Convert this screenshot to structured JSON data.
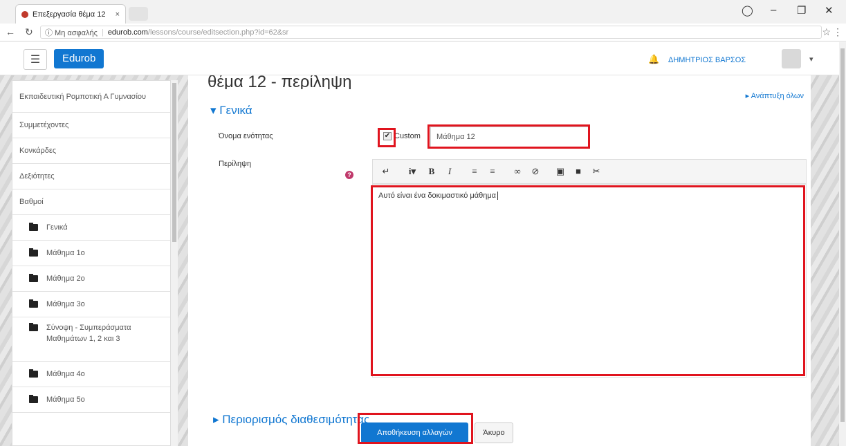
{
  "browser": {
    "tab_title": "Επεξεργασία θέμα 12",
    "tab_close": "×",
    "security_label": "ⓘ Μη ασφαλής",
    "url_domain": "edurob.com",
    "url_path": "/lessons/course/editsection.php?id=62&sr"
  },
  "navbar": {
    "brand": "Edurob",
    "username": "ΔΗΜΗΤΡΙΟΣ ΒΑΡΣΟΣ"
  },
  "sidebar": {
    "items": [
      {
        "label": "Εκπαιδευτική Ρομποτική Α Γυμνασίου",
        "folder": false
      },
      {
        "label": "Συμμετέχοντες",
        "folder": false
      },
      {
        "label": "Κονκάρδες",
        "folder": false
      },
      {
        "label": "Δεξιότητες",
        "folder": false
      },
      {
        "label": "Βαθμοί",
        "folder": false
      },
      {
        "label": "Γενικά",
        "folder": true
      },
      {
        "label": "Μάθημα 1ο",
        "folder": true
      },
      {
        "label": "Μάθημα 2ο",
        "folder": true
      },
      {
        "label": "Μάθημα 3ο",
        "folder": true
      },
      {
        "label": "Σύνοψη - Συμπεράσματα Μαθημάτων 1, 2 και 3",
        "folder": true
      },
      {
        "label": "Μάθημα 4ο",
        "folder": true
      },
      {
        "label": "Μάθημα 5ο",
        "folder": true
      }
    ]
  },
  "main": {
    "page_heading": "θέμα 12 - περίληψη",
    "expand_all": "▸ Ανάπτυξη όλων",
    "section_general": "▾ Γενικά",
    "label_section_name": "Όνομα ενότητας",
    "custom_checkbox_label": "Custom",
    "custom_checked": true,
    "section_name_value": "Μάθημα 12",
    "label_summary": "Περίληψη",
    "editor_text": "Αυτό είναι ένα δοκιμαστικό μάθημα",
    "section_restrict": "▸ Περιορισμός διαθεσιμότητας",
    "save_button": "Αποθήκευση αλλαγών",
    "cancel_button": "Άκυρο"
  },
  "colors": {
    "accent": "#1177d1",
    "highlight": "#e0141e"
  }
}
